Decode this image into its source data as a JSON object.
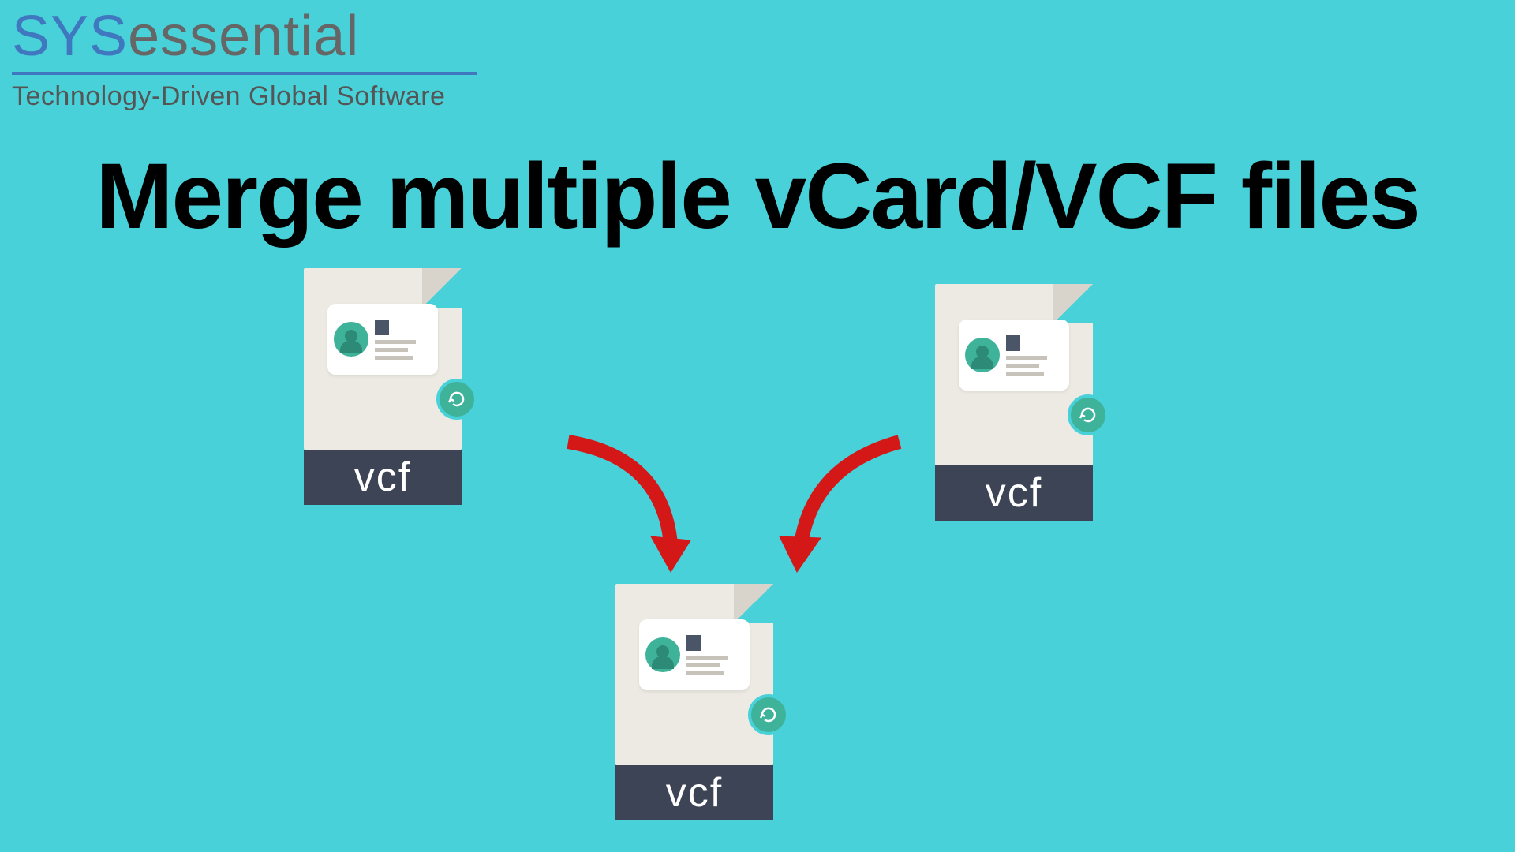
{
  "logo": {
    "part1": "SYS",
    "part2": "essential",
    "tagline": "Technology-Driven Global Software"
  },
  "headline": "Merge multiple vCard/VCF files",
  "file_label": "vcf"
}
